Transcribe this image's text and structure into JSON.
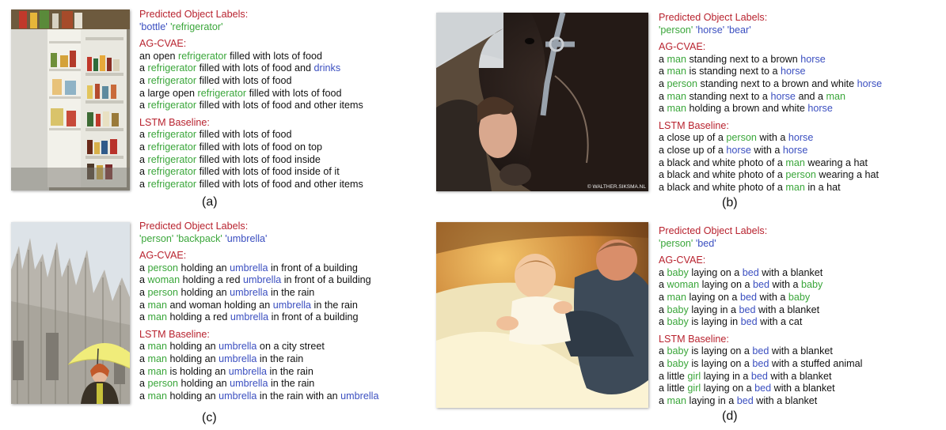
{
  "panels": [
    {
      "id": "a",
      "subfigure_label": "(a)",
      "labels_header": "Predicted Object Labels:",
      "object_labels": [
        {
          "text": "'bottle'",
          "color": "blue"
        },
        {
          "text": "'refrigerator'",
          "color": "green"
        }
      ],
      "agcvae_header": "AG-CVAE:",
      "agcvae": [
        [
          [
            "an open ",
            ""
          ],
          [
            "refrigerator",
            "g"
          ],
          [
            " filled with lots of food",
            ""
          ]
        ],
        [
          [
            "a ",
            ""
          ],
          [
            "refrigerator",
            "g"
          ],
          [
            " filled with lots of food and ",
            ""
          ],
          [
            "drinks",
            "b"
          ]
        ],
        [
          [
            "a ",
            ""
          ],
          [
            "refrigerator",
            "g"
          ],
          [
            " filled with lots of food",
            ""
          ]
        ],
        [
          [
            "a large open ",
            ""
          ],
          [
            "refrigerator",
            "g"
          ],
          [
            " filled with lots of food",
            ""
          ]
        ],
        [
          [
            "a ",
            ""
          ],
          [
            "refrigerator",
            "g"
          ],
          [
            " filled with lots of food and other items",
            ""
          ]
        ]
      ],
      "lstm_header": "LSTM Baseline:",
      "lstm": [
        [
          [
            "a ",
            ""
          ],
          [
            "refrigerator",
            "g"
          ],
          [
            " filled with lots of food",
            ""
          ]
        ],
        [
          [
            "a ",
            ""
          ],
          [
            "refrigerator",
            "g"
          ],
          [
            " filled with lots of food on top",
            ""
          ]
        ],
        [
          [
            "a ",
            ""
          ],
          [
            "refrigerator",
            "g"
          ],
          [
            " filled with lots of food inside",
            ""
          ]
        ],
        [
          [
            "a ",
            ""
          ],
          [
            "refrigerator",
            "g"
          ],
          [
            " filled with lots of food inside of it",
            ""
          ]
        ],
        [
          [
            "a ",
            ""
          ],
          [
            "refrigerator",
            "g"
          ],
          [
            " filled with lots of food and other items",
            ""
          ]
        ]
      ]
    },
    {
      "id": "b",
      "subfigure_label": "(b)",
      "labels_header": "Predicted Object Labels:",
      "object_labels": [
        {
          "text": "'person'",
          "color": "green"
        },
        {
          "text": "'horse'",
          "color": "blue"
        },
        {
          "text": "'bear'",
          "color": "blue"
        }
      ],
      "agcvae_header": "AG-CVAE:",
      "agcvae": [
        [
          [
            "a ",
            ""
          ],
          [
            "man",
            "g"
          ],
          [
            " standing next to a brown ",
            ""
          ],
          [
            "horse",
            "b"
          ]
        ],
        [
          [
            "a ",
            ""
          ],
          [
            "man",
            "g"
          ],
          [
            " is standing next to a ",
            ""
          ],
          [
            "horse",
            "b"
          ]
        ],
        [
          [
            "a ",
            ""
          ],
          [
            "person",
            "g"
          ],
          [
            " standing next to a brown and white ",
            ""
          ],
          [
            "horse",
            "b"
          ]
        ],
        [
          [
            "a ",
            ""
          ],
          [
            "man",
            "g"
          ],
          [
            " standing next to a ",
            ""
          ],
          [
            "horse",
            "b"
          ],
          [
            " and a ",
            ""
          ],
          [
            "man",
            "g"
          ]
        ],
        [
          [
            "a ",
            ""
          ],
          [
            "man",
            "g"
          ],
          [
            " holding a brown and white ",
            ""
          ],
          [
            "horse",
            "b"
          ]
        ]
      ],
      "lstm_header": "LSTM Baseline:",
      "lstm": [
        [
          [
            "a close up of a ",
            ""
          ],
          [
            "person",
            "g"
          ],
          [
            " with a ",
            ""
          ],
          [
            "horse",
            "b"
          ]
        ],
        [
          [
            "a close up of a ",
            ""
          ],
          [
            "horse",
            "b"
          ],
          [
            " with a ",
            ""
          ],
          [
            "horse",
            "b"
          ]
        ],
        [
          [
            "a black and white photo of a ",
            ""
          ],
          [
            "man",
            "g"
          ],
          [
            " wearing a hat",
            ""
          ]
        ],
        [
          [
            "a black and white photo of a ",
            ""
          ],
          [
            "person",
            "g"
          ],
          [
            " wearing a hat",
            ""
          ]
        ],
        [
          [
            "a black and white photo of a ",
            ""
          ],
          [
            "man",
            "g"
          ],
          [
            " in a hat",
            ""
          ]
        ]
      ],
      "watermark": "© WALTHER.SIKSMA.NL"
    },
    {
      "id": "c",
      "subfigure_label": "(c)",
      "labels_header": "Predicted Object Labels:",
      "object_labels": [
        {
          "text": "'person'",
          "color": "green"
        },
        {
          "text": "'backpack'",
          "color": "green"
        },
        {
          "text": "'umbrella'",
          "color": "blue"
        }
      ],
      "agcvae_header": "AG-CVAE:",
      "agcvae": [
        [
          [
            "a ",
            ""
          ],
          [
            "person",
            "g"
          ],
          [
            " holding an ",
            ""
          ],
          [
            "umbrella",
            "b"
          ],
          [
            " in front of a building",
            ""
          ]
        ],
        [
          [
            "a ",
            ""
          ],
          [
            "woman",
            "g"
          ],
          [
            " holding a red ",
            ""
          ],
          [
            "umbrella",
            "b"
          ],
          [
            " in front of a building",
            ""
          ]
        ],
        [
          [
            "a ",
            ""
          ],
          [
            "person",
            "g"
          ],
          [
            " holding an ",
            ""
          ],
          [
            "umbrella",
            "b"
          ],
          [
            " in the rain",
            ""
          ]
        ],
        [
          [
            "a ",
            ""
          ],
          [
            "man",
            "g"
          ],
          [
            " and woman holding an ",
            ""
          ],
          [
            "umbrella",
            "b"
          ],
          [
            " in the rain",
            ""
          ]
        ],
        [
          [
            "a ",
            ""
          ],
          [
            "man",
            "g"
          ],
          [
            " holding a red ",
            ""
          ],
          [
            "umbrella",
            "b"
          ],
          [
            " in front of a building",
            ""
          ]
        ]
      ],
      "lstm_header": "LSTM Baseline:",
      "lstm": [
        [
          [
            "a ",
            ""
          ],
          [
            "man",
            "g"
          ],
          [
            " holding an ",
            ""
          ],
          [
            "umbrella",
            "b"
          ],
          [
            " on a city street",
            ""
          ]
        ],
        [
          [
            "a ",
            ""
          ],
          [
            "man",
            "g"
          ],
          [
            " holding an ",
            ""
          ],
          [
            "umbrella",
            "b"
          ],
          [
            " in the rain",
            ""
          ]
        ],
        [
          [
            "a ",
            ""
          ],
          [
            "man",
            "g"
          ],
          [
            " is holding an ",
            ""
          ],
          [
            "umbrella",
            "b"
          ],
          [
            " in the rain",
            ""
          ]
        ],
        [
          [
            "a ",
            ""
          ],
          [
            "person",
            "g"
          ],
          [
            " holding an ",
            ""
          ],
          [
            "umbrella",
            "b"
          ],
          [
            " in the rain",
            ""
          ]
        ],
        [
          [
            "a ",
            ""
          ],
          [
            "man",
            "g"
          ],
          [
            " holding an ",
            ""
          ],
          [
            "umbrella",
            "b"
          ],
          [
            " in the rain with an ",
            ""
          ],
          [
            "umbrella",
            "b"
          ]
        ]
      ]
    },
    {
      "id": "d",
      "subfigure_label": "(d)",
      "labels_header": "Predicted Object Labels:",
      "object_labels": [
        {
          "text": "'person'",
          "color": "green"
        },
        {
          "text": "'bed'",
          "color": "blue"
        }
      ],
      "agcvae_header": "AG-CVAE:",
      "agcvae": [
        [
          [
            "a ",
            ""
          ],
          [
            "baby",
            "g"
          ],
          [
            " laying on a ",
            ""
          ],
          [
            "bed",
            "b"
          ],
          [
            " with a blanket",
            ""
          ]
        ],
        [
          [
            "a ",
            ""
          ],
          [
            "woman",
            "g"
          ],
          [
            " laying on a ",
            ""
          ],
          [
            "bed",
            "b"
          ],
          [
            " with a ",
            ""
          ],
          [
            "baby",
            "g"
          ]
        ],
        [
          [
            "a ",
            ""
          ],
          [
            "man",
            "g"
          ],
          [
            " laying on a ",
            ""
          ],
          [
            "bed",
            "b"
          ],
          [
            " with a ",
            ""
          ],
          [
            "baby",
            "g"
          ]
        ],
        [
          [
            "a ",
            ""
          ],
          [
            "baby",
            "g"
          ],
          [
            " laying in a ",
            ""
          ],
          [
            "bed",
            "b"
          ],
          [
            " with a blanket",
            ""
          ]
        ],
        [
          [
            "a ",
            ""
          ],
          [
            "baby",
            "g"
          ],
          [
            " is laying in ",
            ""
          ],
          [
            "bed",
            "b"
          ],
          [
            " with a cat",
            ""
          ]
        ]
      ],
      "lstm_header": "LSTM Baseline:",
      "lstm": [
        [
          [
            "a ",
            ""
          ],
          [
            "baby",
            "g"
          ],
          [
            " is laying on a ",
            ""
          ],
          [
            "bed",
            "b"
          ],
          [
            " with a blanket",
            ""
          ]
        ],
        [
          [
            "a ",
            ""
          ],
          [
            "baby",
            "g"
          ],
          [
            " is laying on a ",
            ""
          ],
          [
            "bed",
            "b"
          ],
          [
            " with a stuffed animal",
            ""
          ]
        ],
        [
          [
            "a little ",
            ""
          ],
          [
            "girl",
            "g"
          ],
          [
            " laying in a ",
            ""
          ],
          [
            "bed",
            "b"
          ],
          [
            " with a blanket",
            ""
          ]
        ],
        [
          [
            "a little ",
            ""
          ],
          [
            "girl",
            "g"
          ],
          [
            " laying on a ",
            ""
          ],
          [
            "bed",
            "b"
          ],
          [
            " with a blanket",
            ""
          ]
        ],
        [
          [
            "a ",
            ""
          ],
          [
            "man",
            "g"
          ],
          [
            " laying in a ",
            ""
          ],
          [
            "bed",
            "b"
          ],
          [
            " with a blanket",
            ""
          ]
        ]
      ]
    }
  ],
  "colors": {
    "header": "#b8232f",
    "green": "#3aa63a",
    "blue": "#3b4fc0"
  }
}
